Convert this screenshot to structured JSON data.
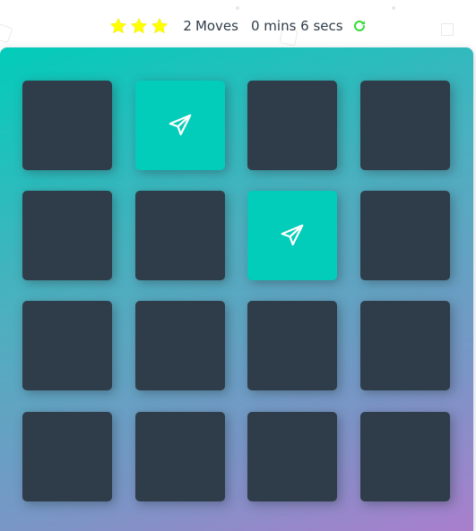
{
  "score_panel": {
    "stars": [
      {
        "icon": "star-icon",
        "filled": true,
        "color": "#ffff00"
      },
      {
        "icon": "star-icon",
        "filled": true,
        "color": "#ffff00"
      },
      {
        "icon": "star-icon",
        "filled": true,
        "color": "#ffff00"
      }
    ],
    "moves_count": "2",
    "moves_label": "Moves",
    "timer_text": "0 mins 6 secs",
    "restart_icon": "refresh-icon",
    "restart_color": "#33dd33"
  },
  "deck": {
    "gradient_colors": [
      "#02ccba",
      "#aa7ecd"
    ],
    "card_back_color": "#2e3d49",
    "card_open_color": "#02ccba",
    "cards": [
      {
        "state": "closed",
        "icon": ""
      },
      {
        "state": "open",
        "icon": "paper-plane-icon"
      },
      {
        "state": "closed",
        "icon": ""
      },
      {
        "state": "closed",
        "icon": ""
      },
      {
        "state": "closed",
        "icon": ""
      },
      {
        "state": "closed",
        "icon": ""
      },
      {
        "state": "open",
        "icon": "paper-plane-icon"
      },
      {
        "state": "closed",
        "icon": ""
      },
      {
        "state": "closed",
        "icon": ""
      },
      {
        "state": "closed",
        "icon": ""
      },
      {
        "state": "closed",
        "icon": ""
      },
      {
        "state": "closed",
        "icon": ""
      },
      {
        "state": "closed",
        "icon": ""
      },
      {
        "state": "closed",
        "icon": ""
      },
      {
        "state": "closed",
        "icon": ""
      },
      {
        "state": "closed",
        "icon": ""
      }
    ]
  }
}
